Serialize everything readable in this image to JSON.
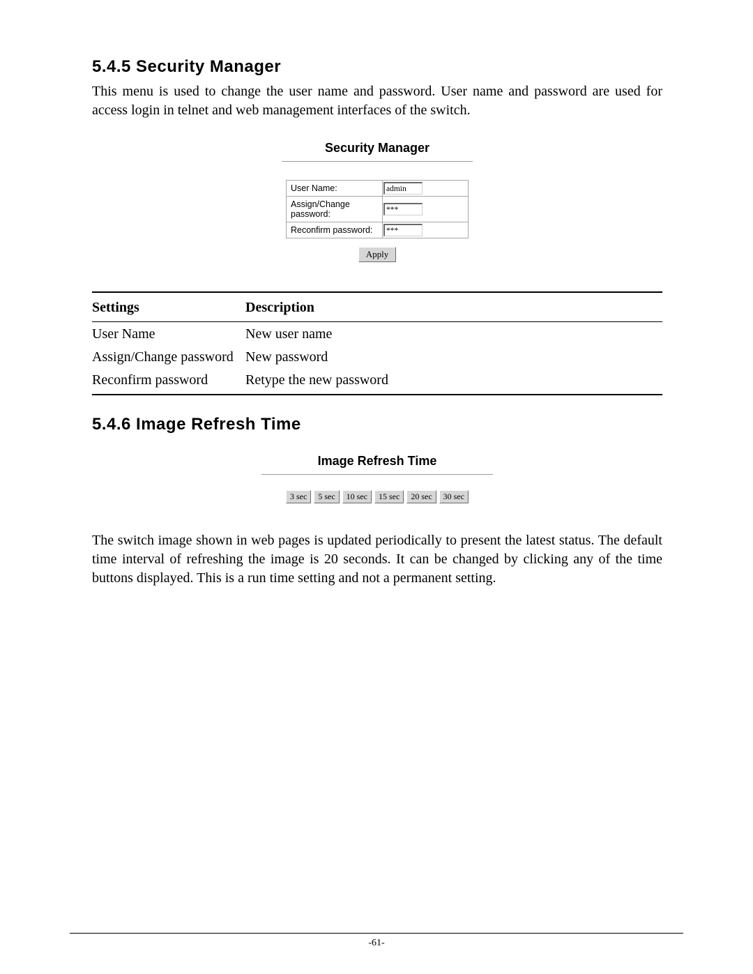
{
  "section1": {
    "heading": "5.4.5 Security Manager",
    "paragraph": "This menu is used to change the user name and password. User name and password are used for access login in telnet and web management interfaces of the switch."
  },
  "securityManager": {
    "title": "Security Manager",
    "rows": {
      "username": {
        "label": "User Name:",
        "value": "admin"
      },
      "assign": {
        "label": "Assign/Change password:",
        "value": "***"
      },
      "reconfirm": {
        "label": "Reconfirm password:",
        "value": "***"
      }
    },
    "applyLabel": "Apply"
  },
  "descTable": {
    "headers": {
      "col1": "Settings",
      "col2": "Description"
    },
    "rows": [
      {
        "s": "User Name",
        "d": "New user name"
      },
      {
        "s": "Assign/Change password",
        "d": "New password"
      },
      {
        "s": "Reconfirm password",
        "d": "Retype the new password"
      }
    ]
  },
  "section2": {
    "heading": "5.4.6 Image Refresh Time"
  },
  "imageRefresh": {
    "title": "Image Refresh Time",
    "buttons": [
      "3 sec",
      "5 sec",
      "10 sec",
      "15 sec",
      "20 sec",
      "30 sec"
    ]
  },
  "section2Paragraph": "The switch image shown in web pages is updated periodically to present the latest status. The default time interval of refreshing the image is 20 seconds. It can be changed by clicking any of the time buttons displayed. This is a run time setting and not a permanent setting.",
  "pageNumber": "-61-"
}
